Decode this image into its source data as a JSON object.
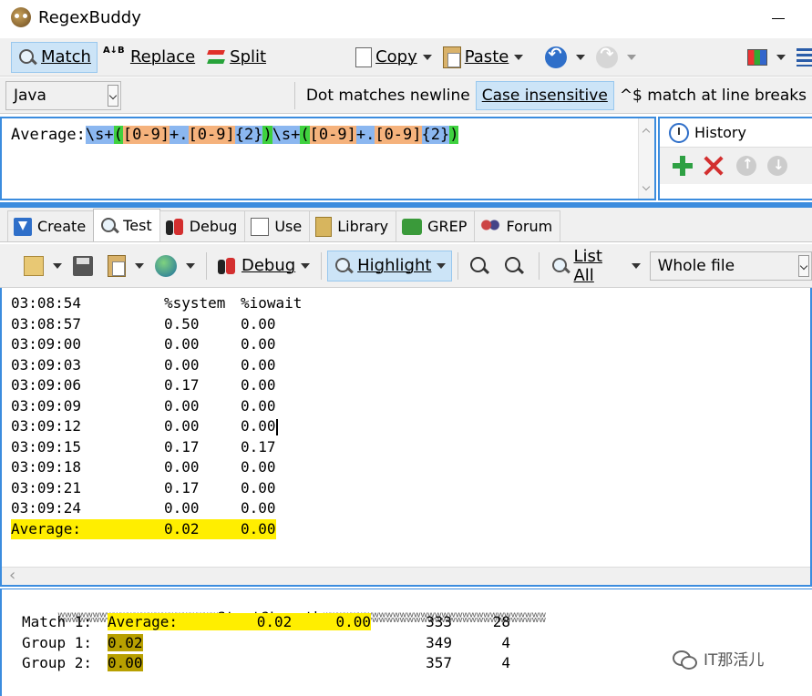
{
  "window": {
    "title": "RegexBuddy"
  },
  "main_toolbar": {
    "match": "Match",
    "replace": "Replace",
    "replace_icon_text": "A↓B",
    "split": "Split",
    "copy": "Copy",
    "paste": "Paste"
  },
  "options": {
    "flavor": "Java",
    "dot_matches_newline": "Dot matches newline",
    "case_insensitive": "Case insensitive",
    "line_breaks": "^$ match at line breaks"
  },
  "regex": {
    "parts": [
      {
        "text": "Average:",
        "hl": ""
      },
      {
        "text": "\\s+",
        "hl": "blue"
      },
      {
        "text": "(",
        "hl": "green"
      },
      {
        "text": "[0-9]",
        "hl": "orange"
      },
      {
        "text": "+.",
        "hl": "blue"
      },
      {
        "text": "[0-9]",
        "hl": "orange"
      },
      {
        "text": "{2}",
        "hl": "blue"
      },
      {
        "text": ")",
        "hl": "green"
      },
      {
        "text": "\\s+",
        "hl": "blue"
      },
      {
        "text": "(",
        "hl": "green"
      },
      {
        "text": "[0-9]",
        "hl": "orange"
      },
      {
        "text": "+.",
        "hl": "blue"
      },
      {
        "text": "[0-9]",
        "hl": "orange"
      },
      {
        "text": "{2}",
        "hl": "blue"
      },
      {
        "text": ")",
        "hl": "green"
      }
    ]
  },
  "history": {
    "title": "History"
  },
  "tabs": {
    "create": "Create",
    "test": "Test",
    "debug": "Debug",
    "use": "Use",
    "library": "Library",
    "grep": "GREP",
    "forum": "Forum"
  },
  "test_toolbar": {
    "debug": "Debug",
    "highlight": "Highlight",
    "list_all": "List All",
    "scope": "Whole file"
  },
  "test_text": [
    {
      "c1": "03:08:54",
      "c2": "%system",
      "c3": "%iowait",
      "match": false
    },
    {
      "c1": "03:08:57",
      "c2": "0.50",
      "c3": "0.00",
      "match": false
    },
    {
      "c1": "03:09:00",
      "c2": "0.00",
      "c3": "0.00",
      "match": false
    },
    {
      "c1": "03:09:03",
      "c2": "0.00",
      "c3": "0.00",
      "match": false
    },
    {
      "c1": "03:09:06",
      "c2": "0.17",
      "c3": "0.00",
      "match": false
    },
    {
      "c1": "03:09:09",
      "c2": "0.00",
      "c3": "0.00",
      "match": false
    },
    {
      "c1": "03:09:12",
      "c2": "0.00",
      "c3": "0.00",
      "match": false,
      "caret": true
    },
    {
      "c1": "03:09:15",
      "c2": "0.17",
      "c3": "0.17",
      "match": false
    },
    {
      "c1": "03:09:18",
      "c2": "0.00",
      "c3": "0.00",
      "match": false
    },
    {
      "c1": "03:09:21",
      "c2": "0.17",
      "c3": "0.00",
      "match": false
    },
    {
      "c1": "03:09:24",
      "c2": "0.00",
      "c3": "0.00",
      "match": false
    },
    {
      "c1": "Average:",
      "c2": "0.02",
      "c3": "0.00",
      "match": true
    }
  ],
  "results": {
    "header_start": "Start",
    "header_sep": "?",
    "header_length": "Length",
    "rows": [
      {
        "label": "Match 1:",
        "text": "Average:         0.02     0.00",
        "start": "333",
        "length": "28",
        "kind": "match"
      },
      {
        "label": "Group 1:",
        "text": "0.02",
        "start": "349",
        "length": "4",
        "kind": "group"
      },
      {
        "label": "Group 2:",
        "text": "0.00",
        "start": "357",
        "length": "4",
        "kind": "group"
      }
    ]
  },
  "watermark": {
    "text": "IT那活儿"
  }
}
